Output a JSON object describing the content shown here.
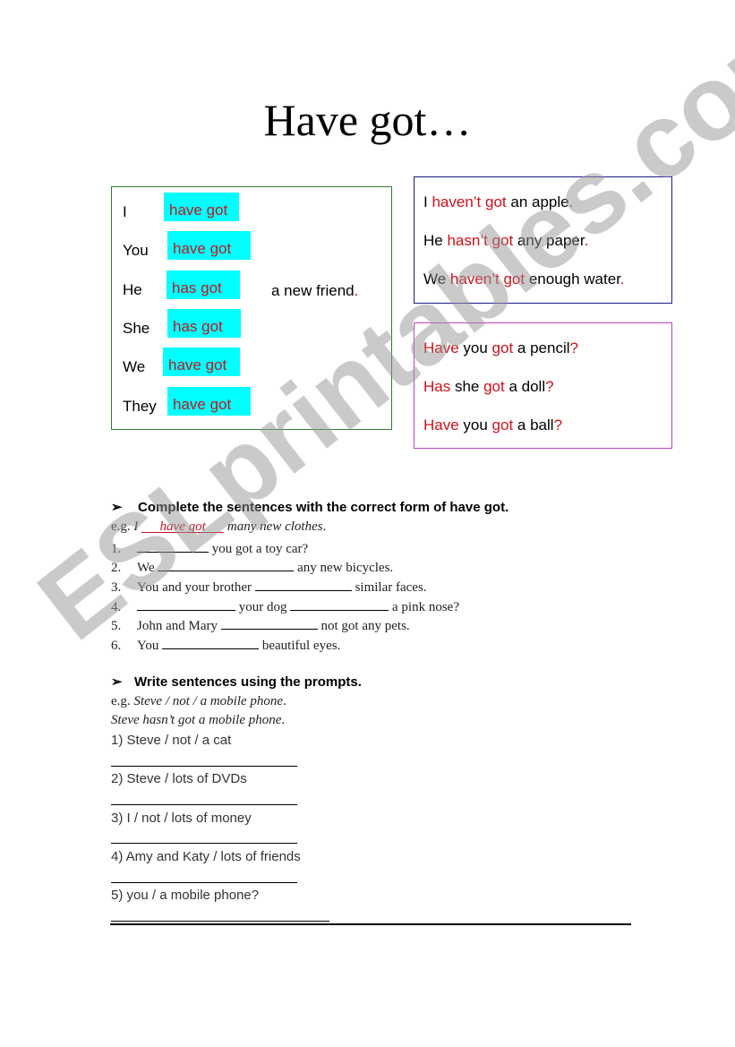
{
  "title": "Have got…",
  "affirmative_box": {
    "rows": [
      {
        "subject": "I",
        "verb": "have got"
      },
      {
        "subject": "You",
        "verb": "have got"
      },
      {
        "subject": "He",
        "verb": "has got"
      },
      {
        "subject": "She",
        "verb": "has got"
      },
      {
        "subject": "We",
        "verb": "have got"
      },
      {
        "subject": "They",
        "verb": "have got"
      }
    ],
    "object": "a new friend",
    "object_punct": "."
  },
  "negative_box": {
    "lines": [
      {
        "pre": "I ",
        "red": "haven’t got",
        "post": " an apple",
        "punct": "."
      },
      {
        "pre": "He ",
        "red": "hasn’t got",
        "post": " any paper",
        "punct": "."
      },
      {
        "pre": "We ",
        "red": "haven’t got",
        "post": " enough water",
        "punct": "."
      }
    ]
  },
  "question_box": {
    "lines": [
      {
        "aux": "Have",
        "mid": " you ",
        "got": "got",
        "post": " a pencil",
        "punct": "?"
      },
      {
        "aux": "Has",
        "mid": " she ",
        "got": "got",
        "post": " a doll",
        "punct": "?"
      },
      {
        "aux": "Have",
        "mid": " you ",
        "got": "got",
        "post": " a ball",
        "punct": "?"
      }
    ]
  },
  "exercise1": {
    "heading": "Complete the sentences with the correct form of have got.",
    "example_prefix": "e.g. ",
    "example_subject": "I",
    "example_answer": "have got",
    "example_rest": "many new clothes",
    "items": [
      {
        "num": "1.",
        "before": "",
        "after": "you got a toy car?",
        "blank2": false
      },
      {
        "num": "2.",
        "before": "We",
        "after": "any new bicycles.",
        "blank2": false
      },
      {
        "num": "3.",
        "before": "You and your brother",
        "after": "similar faces.",
        "blank2": false
      },
      {
        "num": "4.",
        "before": "",
        "middle": "your dog",
        "after": "a pink nose?",
        "blank2": true
      },
      {
        "num": "5.",
        "before": "John and Mary",
        "after": "not got any pets.",
        "blank2": false
      },
      {
        "num": "6.",
        "before": "You",
        "after": "beautiful eyes.",
        "blank2": false
      }
    ]
  },
  "exercise2": {
    "heading": "Write sentences using the prompts.",
    "example_prefix": "e.g. ",
    "example_prompt": "Steve / not / a mobile phone",
    "example_answer": "Steve hasn’t got a mobile phone",
    "prompts": [
      "1) Steve / not / a cat",
      "2) Steve / lots of DVDs",
      "3) I / not / lots of money",
      "4) Amy and Katy / lots of friends",
      "5) you / a mobile phone?"
    ]
  },
  "watermark": "ESLprintables.com",
  "colors": {
    "highlight": "#00ffff",
    "red": "#d0101a",
    "green_border": "#2e7d32",
    "blue_border": "#1a1a8c",
    "pink_border": "#c040c0"
  }
}
